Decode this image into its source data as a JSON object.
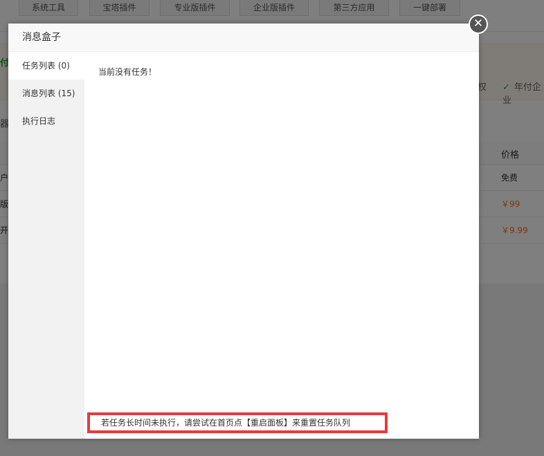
{
  "background": {
    "top_tabs": [
      "系统工具",
      "宝塔插件",
      "专业版插件",
      "企业版插件",
      "第三方应用",
      "一键部署"
    ],
    "notice": {
      "title_fragment": "付",
      "items": [
        "权",
        "年付企业"
      ]
    },
    "filter_fragment": "器",
    "table": {
      "price_header": "价格",
      "rows": [
        {
          "name_fragment": "户",
          "price": "免费"
        },
        {
          "name_fragment": "版",
          "price": "￥99"
        },
        {
          "name_fragment": "开",
          "price": "￥9.99"
        }
      ]
    }
  },
  "modal": {
    "title": "消息盒子",
    "close_glyph": "✕",
    "nav": [
      {
        "label": "任务列表 (0)",
        "active": true
      },
      {
        "label": "消息列表 (15)",
        "active": false
      },
      {
        "label": "执行日志",
        "active": false
      }
    ],
    "empty_message": "当前没有任务！",
    "tip": "若任务长时间未执行，请尝试在首页点【重启面板】来重置任务队列"
  },
  "colors": {
    "accent_green": "#20a53a",
    "price_orange": "#fc6d26",
    "highlight_red": "#e83a3a"
  }
}
